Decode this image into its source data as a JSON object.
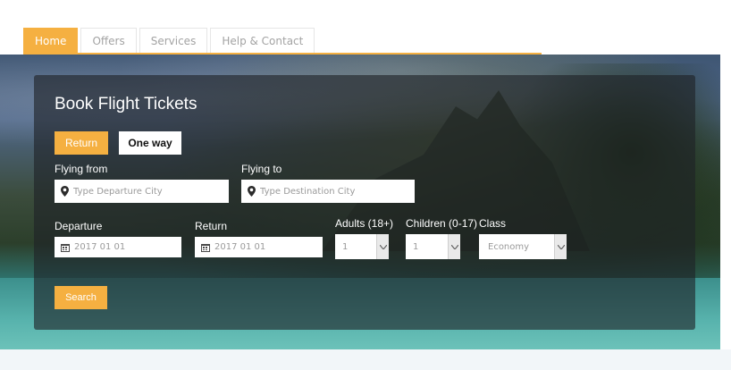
{
  "nav": {
    "tabs": [
      {
        "label": "Home",
        "active": true
      },
      {
        "label": "Offers",
        "active": false
      },
      {
        "label": "Services",
        "active": false
      },
      {
        "label": "Help & Contact",
        "active": false
      }
    ]
  },
  "booking": {
    "title": "Book Flight Tickets",
    "trip_types": {
      "return_label": "Return",
      "oneway_label": "One way",
      "selected": "Return"
    },
    "flying_from": {
      "label": "Flying from",
      "placeholder": "Type Departure City",
      "icon": "map-pin-icon"
    },
    "flying_to": {
      "label": "Flying to",
      "placeholder": "Type Destination City",
      "icon": "map-pin-icon"
    },
    "departure": {
      "label": "Departure",
      "value": "2017 01 01",
      "icon": "calendar-icon"
    },
    "return_date": {
      "label": "Return",
      "value": "2017 01 01",
      "icon": "calendar-icon"
    },
    "adults": {
      "label": "Adults (18+)",
      "value": "1"
    },
    "children": {
      "label": "Children (0-17)",
      "value": "1"
    },
    "class": {
      "label": "Class",
      "value": "Economy"
    },
    "search_label": "Search"
  },
  "colors": {
    "accent": "#f5b041",
    "panel_overlay": "rgba(30,34,38,0.62)",
    "text_light": "#ffffff",
    "placeholder": "#9a9a9a"
  }
}
